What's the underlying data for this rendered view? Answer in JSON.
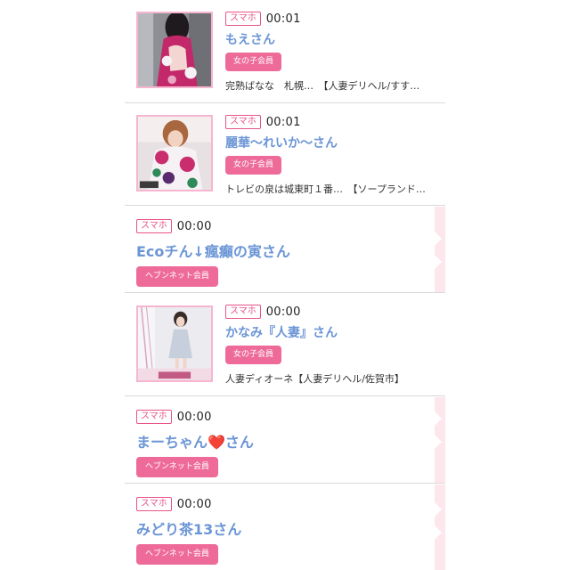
{
  "colors": {
    "name_text": "#6b95d6",
    "badge_pink": "#e8548a",
    "member_button": "#ee6b99",
    "thumb_border": "#f6b6cf",
    "side_tab": "#fde6ec"
  },
  "entries": [
    {
      "device_badge": "スマホ",
      "time": "00:01",
      "name": "もえさん",
      "member_label": "女の子会員",
      "shop": "完熟ばなな　札幌…　【人妻デリヘル/すす…",
      "thumbnail": "photo-woman-pink-kimono"
    },
    {
      "device_badge": "スマホ",
      "time": "00:01",
      "name": "麗華〜れいか〜さん",
      "member_label": "女の子会員",
      "shop": "トレビの泉は城東町１番…　【ソープランド…",
      "thumbnail": "photo-woman-floral-yukata"
    },
    {
      "device_badge": "スマホ",
      "time": "00:00",
      "name": "Ecoチん↓瘋癲の寅さん",
      "member_label": "ヘブンネット会員"
    },
    {
      "device_badge": "スマホ",
      "time": "00:00",
      "name": "かなみ『人妻』さん",
      "member_label": "女の子会員",
      "shop": "人妻ディオーネ【人妻デリヘル/佐賀市】",
      "thumbnail": "photo-woman-white-dress"
    },
    {
      "device_badge": "スマホ",
      "time": "00:00",
      "name": "まーちゃん❤️さん",
      "member_label": "ヘブンネット会員"
    },
    {
      "device_badge": "スマホ",
      "time": "00:00",
      "name": "みどり茶13さん",
      "member_label": "ヘブンネット会員"
    }
  ]
}
